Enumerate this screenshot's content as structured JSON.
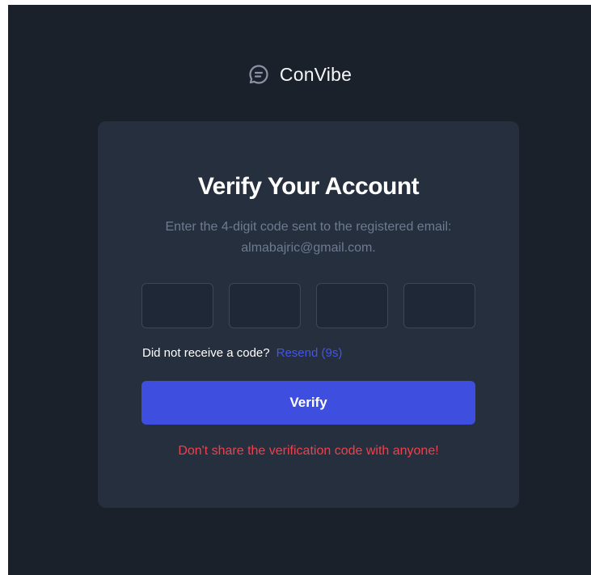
{
  "brand": {
    "icon": "chat-bubble-icon",
    "name": "ConVibe"
  },
  "verify": {
    "title": "Verify Your Account",
    "subtitle": "Enter the 4-digit code sent to the registered email: almabajric@gmail.com.",
    "code_digits": [
      "",
      "",
      "",
      ""
    ],
    "resend_prompt": "Did not receive a code?",
    "resend_link": "Resend (9s)",
    "button_label": "Verify",
    "warning": "Don't share the verification code with anyone!"
  },
  "colors": {
    "background": "#1b212a",
    "card": "#252f3e",
    "accent": "#3e4fe0",
    "link": "#4655e2",
    "warning": "#f1404a",
    "muted_text": "#6e7b90"
  }
}
